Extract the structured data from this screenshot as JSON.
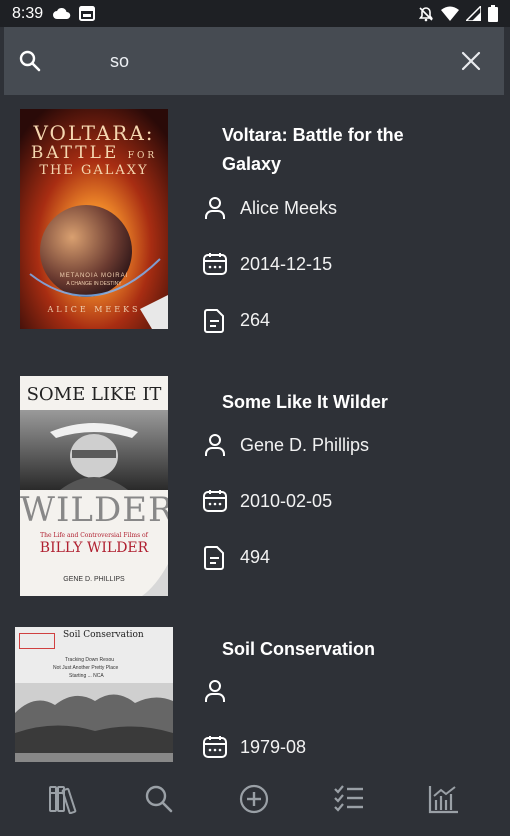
{
  "status_bar": {
    "time": "8:39"
  },
  "search": {
    "query": "so"
  },
  "results": [
    {
      "title": "Voltara: Battle for the Galaxy",
      "author": "Alice Meeks",
      "date": "2014-12-15",
      "pages": "264",
      "cover": {
        "title_line1": "VOLTARA:",
        "title_line2": "BATTLE",
        "title_line3": "FOR",
        "title_line4": "THE GALAXY",
        "subtitle": "METANOIA MOIRAI",
        "subtitle2": "A CHANGE IN DESTINY",
        "author": "ALICE MEEKS"
      }
    },
    {
      "title": "Some Like It Wilder",
      "author": "Gene D. Phillips",
      "date": "2010-02-05",
      "pages": "494",
      "cover": {
        "top": "SOME LIKE IT",
        "big": "WILDER",
        "sub1": "The Life and Controversial Films of",
        "sub2": "BILLY WILDER",
        "author": "GENE D. PHILLIPS"
      }
    },
    {
      "title": "Soil Conservation",
      "author": "",
      "date": "1979-08",
      "cover": {
        "heading": "Soil Conservation",
        "l1": "Tracking Down Resou",
        "l2": "Not Just Another Pretty Place",
        "l3": "Starting ... NCA"
      }
    }
  ],
  "colors": {
    "background": "#2e3137",
    "search_bar": "#464b52",
    "status_bar": "#1e2024"
  }
}
